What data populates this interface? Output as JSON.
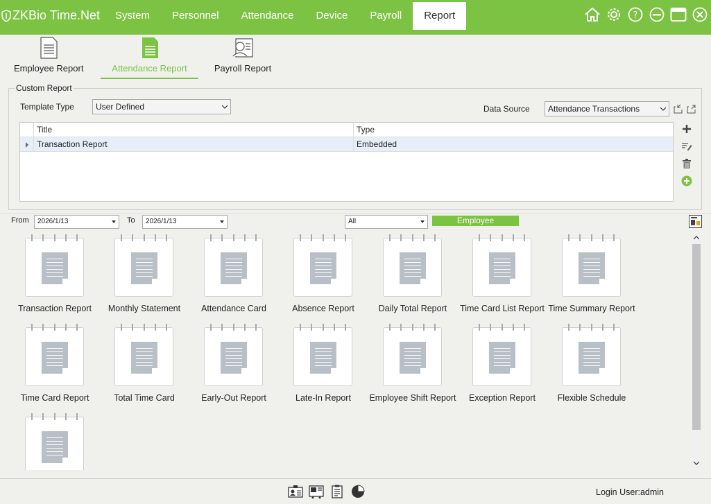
{
  "app": {
    "logo_zk": "ZK",
    "logo_rest": "Bio Time.Net"
  },
  "nav": [
    {
      "label": "System"
    },
    {
      "label": "Personnel"
    },
    {
      "label": "Attendance"
    },
    {
      "label": "Device"
    },
    {
      "label": "Payroll"
    },
    {
      "label": "Report",
      "active": true
    }
  ],
  "window_icons": [
    "home-icon",
    "gear-icon",
    "help-icon",
    "minimize-icon",
    "maximize-icon",
    "close-icon"
  ],
  "subnav": [
    {
      "label": "Employee Report",
      "icon": "document-icon"
    },
    {
      "label": "Attendance Report",
      "icon": "document-green-icon",
      "active": true
    },
    {
      "label": "Payroll Report",
      "icon": "payroll-icon"
    }
  ],
  "custom_report": {
    "legend": "Custom Report",
    "template_type_label": "Template Type",
    "template_type_value": "User Defined",
    "data_source_label": "Data Source",
    "data_source_value": "Attendance Transactions",
    "columns": [
      "Title",
      "Type"
    ],
    "rows": [
      {
        "title": "Transaction Report",
        "type": "Embedded"
      }
    ]
  },
  "filters": {
    "from_label": "From",
    "from_value": "2026/1/13",
    "to_label": "To",
    "to_value": "2026/1/13",
    "scope_value": "All",
    "employee_button": "Employee"
  },
  "reports": [
    "Transaction Report",
    "Monthly Statement",
    "Attendance Card",
    "Absence Report",
    "Daily Total Report",
    "Time Card List Report",
    "Time Summary Report",
    "Time Card Report",
    "Total Time Card",
    "Early-Out Report",
    "Late-In Report",
    "Employee Shift Report",
    "Exception Report",
    "Flexible Schedule",
    ""
  ],
  "footer": {
    "login_user": "Login User:admin"
  },
  "colors": {
    "accent": "#7cc243"
  }
}
